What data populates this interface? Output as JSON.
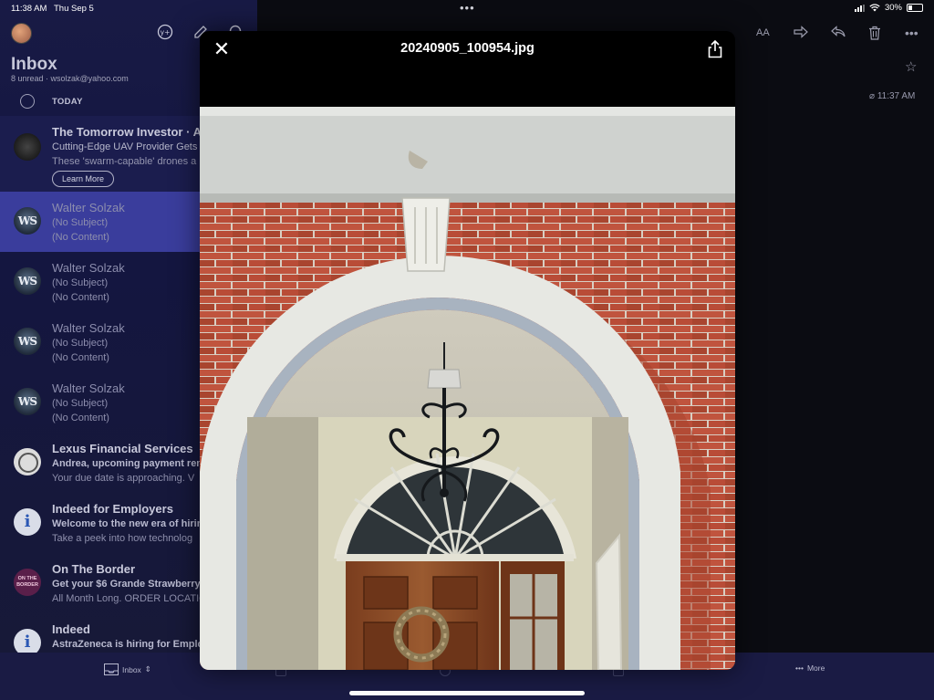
{
  "status_bar": {
    "time": "11:38 AM",
    "date": "Thu Sep 5",
    "battery": "30%"
  },
  "sidebar": {
    "title": "Inbox",
    "subtitle": "8 unread · wsolzak@yahoo.com",
    "section_label": "TODAY",
    "mails": [
      {
        "sender": "The Tomorrow Investor · A",
        "line1": "Cutting-Edge UAV Provider Gets",
        "line2": "These 'swarm-capable' drones a",
        "cta": "Learn More",
        "type": "ad",
        "avatar": "investor-logo-icon"
      },
      {
        "sender": "Walter Solzak",
        "line1": "(No Subject)",
        "line2": "(No Content)",
        "type": "selected",
        "avatar": "WS"
      },
      {
        "sender": "Walter Solzak",
        "line1": "(No Subject)",
        "line2": "(No Content)",
        "type": "read",
        "avatar": "WS"
      },
      {
        "sender": "Walter Solzak",
        "line1": "(No Subject)",
        "line2": "(No Content)",
        "type": "read",
        "avatar": "WS"
      },
      {
        "sender": "Walter Solzak",
        "line1": "(No Subject)",
        "line2": "(No Content)",
        "type": "read",
        "avatar": "WS"
      },
      {
        "sender": "Lexus Financial Services",
        "line1": "Andrea, upcoming payment rem",
        "line2": "Your due date is approaching. V",
        "type": "unread",
        "avatar": "lexus-logo-icon"
      },
      {
        "sender": "Indeed for Employers",
        "line1": "Welcome to the new era of hirin",
        "line2": "Take a peek into how technolog",
        "type": "unread",
        "avatar": "info-icon"
      },
      {
        "sender": "On The Border",
        "line1": "Get your $6 Grande Strawberry",
        "line2": "All Month Long. ORDER LOCATIO",
        "type": "unread",
        "avatar": "ON THE BORDER"
      },
      {
        "sender": "Indeed",
        "line1": "AstraZeneca is hiring for Emplo",
        "line2": "",
        "type": "unread",
        "avatar": "info-icon"
      }
    ]
  },
  "right_pane": {
    "time": "11:37 AM"
  },
  "bottom_bar": {
    "inbox_label": "Inbox",
    "more_label": "More"
  },
  "viewer": {
    "filename": "20240905_100954.jpg",
    "close_glyph": "✕"
  },
  "colors": {
    "sidebar_bg": "#171940",
    "selected_row": "#3a3d9c",
    "brick": "#b44a36",
    "trim": "#e6e6e0",
    "door_wood": "#8a4a26"
  }
}
